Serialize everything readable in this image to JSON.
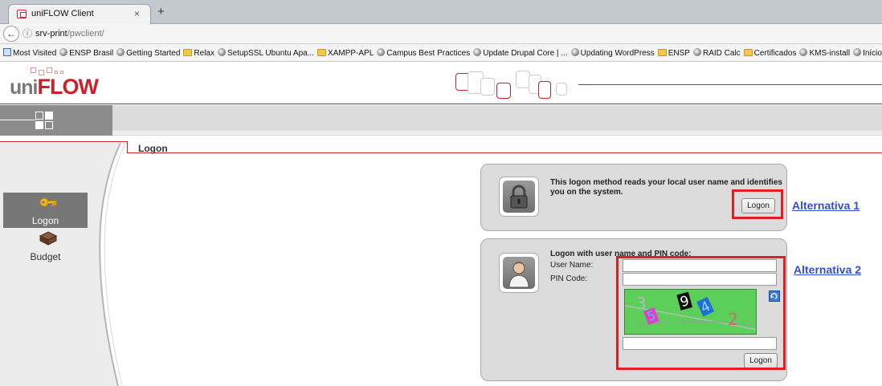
{
  "browser": {
    "tab_title": "uniFLOW Client",
    "tab_close": "×",
    "new_tab": "+",
    "url_host": "srv-print",
    "url_path": "/pwclient/",
    "bookmarks": [
      {
        "type": "f",
        "label": "Most Visited"
      },
      {
        "type": "g",
        "label": "ENSP Brasil"
      },
      {
        "type": "g",
        "label": "Getting Started"
      },
      {
        "type": "f",
        "label": "Relax"
      },
      {
        "type": "g",
        "label": "SetupSSL Ubuntu Apa..."
      },
      {
        "type": "f",
        "label": "XAMPP-APL"
      },
      {
        "type": "g",
        "label": "Campus Best Practices"
      },
      {
        "type": "g",
        "label": "Update Drupal Core | ..."
      },
      {
        "type": "g",
        "label": "Updating WordPress"
      },
      {
        "type": "f",
        "label": "ENSP"
      },
      {
        "type": "g",
        "label": "RAID Calc"
      },
      {
        "type": "f",
        "label": "Certificados"
      },
      {
        "type": "g",
        "label": "KMS-install"
      },
      {
        "type": "g",
        "label": "Início - SP.gov."
      }
    ]
  },
  "app": {
    "logo_uni": "uni",
    "logo_flow": "FLOW",
    "breadcrumb": "Logon",
    "nav": {
      "logon": "Logon",
      "budget": "Budget"
    },
    "panel1": {
      "text": "This logon method reads your local user name and identifies you on the system.",
      "button": "Logon"
    },
    "panel2": {
      "title": "Logon with user name and PIN code:",
      "user_label": "User Name:",
      "pin_label": "PIN Code:",
      "button": "Logon",
      "captcha_chars": [
        "3",
        "5",
        "9",
        "4",
        "2"
      ]
    },
    "annotations": {
      "alt1": "Alternativa 1",
      "alt2": "Alternativa 2"
    },
    "colors": {
      "brand_red": "#c8232c",
      "annotation_red": "#e01e24",
      "annotation_link": "#2f4fd8"
    }
  }
}
